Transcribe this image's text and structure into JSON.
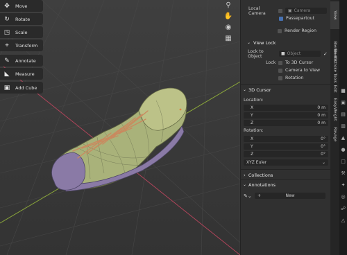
{
  "toolbar": {
    "items": [
      {
        "label": "Move",
        "icon": "move-icon"
      },
      {
        "label": "Rotate",
        "icon": "rotate-icon"
      },
      {
        "label": "Scale",
        "icon": "scale-icon"
      },
      {
        "label": "Transform",
        "icon": "transform-icon"
      },
      {
        "label": "Annotate",
        "icon": "annotate-icon"
      },
      {
        "label": "Measure",
        "icon": "measure-icon"
      },
      {
        "label": "Add Cube",
        "icon": "add-cube-icon"
      }
    ]
  },
  "nav_icons": [
    "zoom-icon",
    "hand-pan-icon",
    "camera-view-icon",
    "grid-ortho-icon"
  ],
  "view_panel": {
    "local_camera_label": "Local Camera",
    "camera_placeholder": "Camera",
    "passepartout_label": "Passepartout",
    "passepartout_checked": true,
    "render_region_label": "Render Region",
    "view_lock_header": "View Lock",
    "lock_to_object_label": "Lock to Object",
    "object_placeholder": "Object",
    "lock_label": "Lock",
    "to_3d_cursor_label": "To 3D Cursor",
    "camera_to_view_label": "Camera to View",
    "rotation_label": "Rotation"
  },
  "cursor_panel": {
    "header": "3D Cursor",
    "location_label": "Location:",
    "location": [
      {
        "axis": "X",
        "value": "0 m"
      },
      {
        "axis": "Y",
        "value": "0 m"
      },
      {
        "axis": "Z",
        "value": "0 m"
      }
    ],
    "rotation_label": "Rotation:",
    "rotation": [
      {
        "axis": "X",
        "value": "0°"
      },
      {
        "axis": "Y",
        "value": "0°"
      },
      {
        "axis": "Z",
        "value": "0°"
      }
    ],
    "rotation_mode": "XYZ Euler"
  },
  "collections_header": "Collections",
  "annotations_header": "Annotations",
  "annotations_new": "New",
  "vertical_tabs": [
    "View",
    "BlenderKit",
    "Brushstroke Tools",
    "Edit",
    "EasyWeight",
    "Ravage"
  ],
  "colors": {
    "viewport_bg": "#3b3b3b",
    "panel_bg": "#303030",
    "accent_blue": "#4772b3",
    "x_axis": "#b0445a",
    "y_axis": "#8aa63a",
    "shoe_upper": "#a9b27a",
    "shoe_toe": "#8a7aa6",
    "laces": "#c98a5f"
  }
}
